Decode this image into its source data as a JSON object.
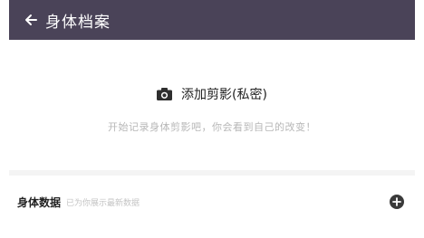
{
  "header": {
    "title": "身体档案",
    "back_icon": "back-arrow-icon"
  },
  "add_clip": {
    "icon": "camera-icon",
    "label": "添加剪影(私密)",
    "hint": "开始记录身体剪影吧，你会看到自己的改变！"
  },
  "body_data": {
    "title": "身体数据",
    "subtitle": "已为你展示最新数据",
    "add_icon": "plus-circle-icon"
  },
  "colors": {
    "header_bg": "#4a4358",
    "header_text": "#ffffff",
    "hint_text": "#b7b7b7",
    "divider": "#f4f4f4",
    "add_button": "#3a3a3a"
  }
}
